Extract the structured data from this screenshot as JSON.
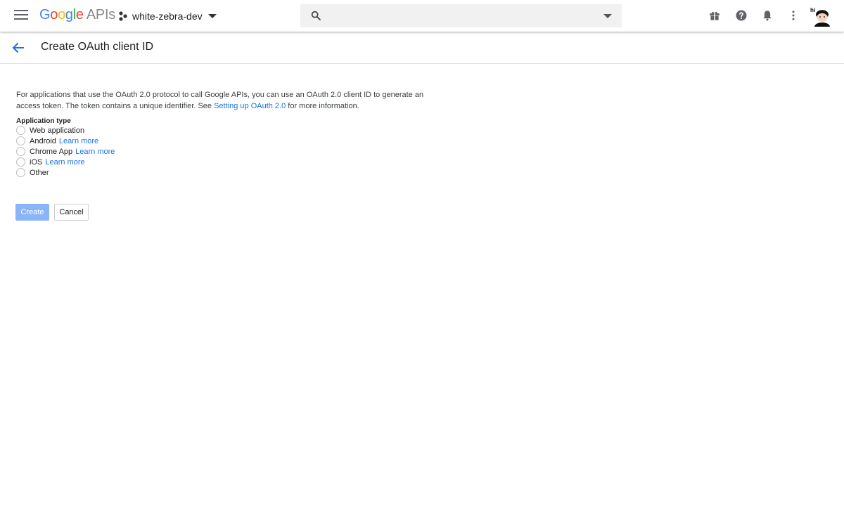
{
  "topbar": {
    "logo_google": "Google",
    "logo_apis": "APIs",
    "project_name": "white-zebra-dev",
    "avatar_text": "hi",
    "icons": [
      "menu-icon",
      "project-dots-icon",
      "search-icon",
      "chevron-down-icon",
      "gift-icon",
      "help-icon",
      "notifications-icon",
      "more-vert-icon",
      "avatar"
    ]
  },
  "page": {
    "title": "Create OAuth client ID",
    "intro_text": "For applications that use the OAuth 2.0 protocol to call Google APIs, you can use an OAuth 2.0 client ID to generate an access token. The token contains a unique identifier. See ",
    "intro_link": "Setting up OAuth 2.0",
    "intro_suffix": " for more information."
  },
  "form": {
    "application_type_label": "Application type",
    "options": [
      {
        "label": "Web application",
        "link": ""
      },
      {
        "label": "Android",
        "link": "Learn more"
      },
      {
        "label": "Chrome App",
        "link": "Learn more"
      },
      {
        "label": "iOS",
        "link": "Learn more"
      },
      {
        "label": "Other",
        "link": ""
      }
    ],
    "create_label": "Create",
    "cancel_label": "Cancel"
  },
  "colors": {
    "link": "#1a73e8",
    "create_button_disabled": "#8ab4f8",
    "google_blue": "#4285f4",
    "google_red": "#ea4335",
    "google_yellow": "#fbbc05",
    "google_green": "#34a853"
  }
}
